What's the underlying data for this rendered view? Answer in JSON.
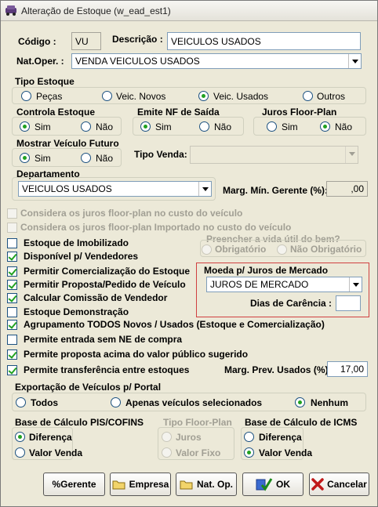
{
  "window": {
    "title": "Alteração de Estoque (w_ead_est1)"
  },
  "header": {
    "codigo_label": "Código :",
    "codigo_value": "VU",
    "descricao_label": "Descrição :",
    "descricao_value": "VEICULOS USADOS",
    "natoper_label": "Nat.Oper. :",
    "natoper_value": "VENDA VEICULOS USADOS"
  },
  "tipo_estoque": {
    "label": "Tipo Estoque",
    "options": [
      "Peças",
      "Veic. Novos",
      "Veic. Usados",
      "Outros"
    ],
    "selected": "Veic. Usados"
  },
  "controla_estoque": {
    "label": "Controla Estoque",
    "yes": "Sim",
    "no": "Não",
    "selected": "Sim"
  },
  "emite_nf": {
    "label": "Emite NF de Saída",
    "yes": "Sim",
    "no": "Não",
    "selected": "Sim"
  },
  "juros_floor": {
    "label": "Juros Floor-Plan",
    "yes": "Sim",
    "no": "Não",
    "selected": "Não"
  },
  "mostrar_veiculo": {
    "label": "Mostrar Veículo Futuro",
    "yes": "Sim",
    "no": "Não",
    "selected": "Sim"
  },
  "tipo_venda": {
    "label": "Tipo Venda:",
    "value": ""
  },
  "departamento": {
    "label": "Departamento",
    "value": "VEICULOS USADOS"
  },
  "margem_min": {
    "label": "Marg. Mín. Gerente (%):",
    "value": ",00"
  },
  "checkboxes_disabled": [
    {
      "label": "Considera os juros floor-plan no custo do veículo",
      "checked": false
    },
    {
      "label": "Considera os juros floor-plan Importado no custo do veículo",
      "checked": false
    }
  ],
  "vida_util": {
    "label": "Preencher a vida útil do bem?",
    "opt1": "Obrigatório",
    "opt2": "Não Obrigatório"
  },
  "checkboxes": [
    {
      "label": "Estoque de Imobilizado",
      "checked": false
    },
    {
      "label": "Disponível p/ Vendedores",
      "checked": true
    },
    {
      "label": "Permitir Comercialização do Estoque",
      "checked": true
    },
    {
      "label": "Permitir Proposta/Pedido de Veículo",
      "checked": true
    },
    {
      "label": "Calcular Comissão de Vendedor",
      "checked": true
    },
    {
      "label": "Estoque Demonstração",
      "checked": false
    },
    {
      "label": "Agrupamento TODOS Novos / Usados (Estoque e Comercialização)",
      "checked": true
    },
    {
      "label": "Permite entrada sem NE de compra",
      "checked": false
    },
    {
      "label": "Permite proposta acima do valor público sugerido",
      "checked": true
    },
    {
      "label": "Permite transferência entre estoques",
      "checked": true
    }
  ],
  "moeda": {
    "label": "Moeda p/ Juros de Mercado",
    "value": "JUROS DE MERCADO",
    "dias_label": "Dias de Carência :",
    "dias_value": ""
  },
  "marg_prev": {
    "label": "Marg. Prev. Usados (%):",
    "value": "17,00"
  },
  "exportacao": {
    "label": "Exportação de Veículos p/ Portal",
    "options": [
      "Todos",
      "Apenas veículos selecionados",
      "Nenhum"
    ],
    "selected": "Nenhum"
  },
  "pis_cofins": {
    "label": "Base de Cálculo PIS/COFINS",
    "opt1": "Diferença",
    "opt2": "Valor Venda",
    "selected": "Diferença"
  },
  "tipo_floor": {
    "label": "Tipo Floor-Plan",
    "opt1": "Juros",
    "opt2": "Valor Fixo"
  },
  "icms": {
    "label": "Base de Cálculo de ICMS",
    "opt1": "Diferença",
    "opt2": "Valor Venda",
    "selected": "Valor Venda"
  },
  "buttons": {
    "gerente": "%Gerente",
    "empresa": "Empresa",
    "natop": "Nat. Op.",
    "ok": "OK",
    "cancelar": "Cancelar"
  }
}
